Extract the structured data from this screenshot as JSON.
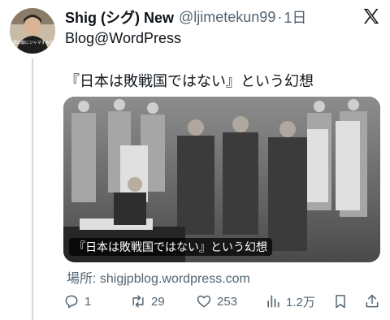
{
  "avatar": {
    "overlay_text": "僕の飯にジャマする奴",
    "icon": "avatar"
  },
  "tweet": {
    "display_name": "Shig (シグ) New",
    "handle": "@ljimetekun99",
    "separator": "·",
    "time": "1日",
    "text_line1": "Blog@WordPress",
    "text_line2": "『日本は敗戦国ではない』という幻想"
  },
  "card": {
    "caption": "『日本は敗戦国ではない』という幻想",
    "source": "場所: shigjpblog.wordpress.com"
  },
  "actions": {
    "reply_count": "1",
    "retweet_count": "29",
    "like_count": "253",
    "views_count": "1.2万"
  },
  "icons": [
    "x-logo-icon",
    "reply-icon",
    "retweet-icon",
    "like-icon",
    "views-icon",
    "bookmark-icon",
    "share-icon"
  ]
}
